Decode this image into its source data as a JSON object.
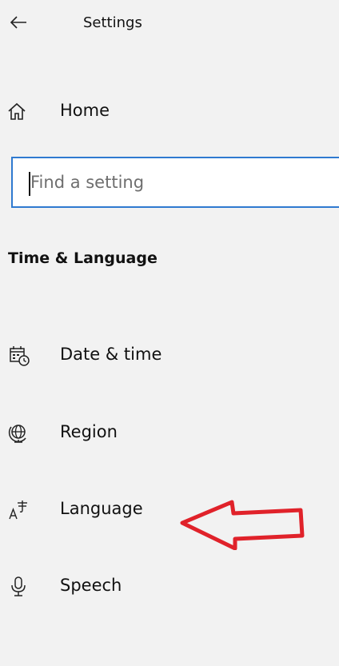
{
  "header": {
    "title": "Settings",
    "back_icon": "back-arrow-icon"
  },
  "nav": {
    "home_label": "Home",
    "home_icon": "home-icon"
  },
  "search": {
    "placeholder": "Find a setting",
    "value": ""
  },
  "section": {
    "heading": "Time & Language"
  },
  "items": [
    {
      "label": "Date & time",
      "icon": "calendar-clock-icon"
    },
    {
      "label": "Region",
      "icon": "globe-icon"
    },
    {
      "label": "Language",
      "icon": "language-icon"
    },
    {
      "label": "Speech",
      "icon": "microphone-icon"
    }
  ],
  "annotation": {
    "color": "#e0222a",
    "points_to": "Language"
  },
  "colors": {
    "background": "#f2f2f2",
    "search_border": "#2f7ad0"
  }
}
